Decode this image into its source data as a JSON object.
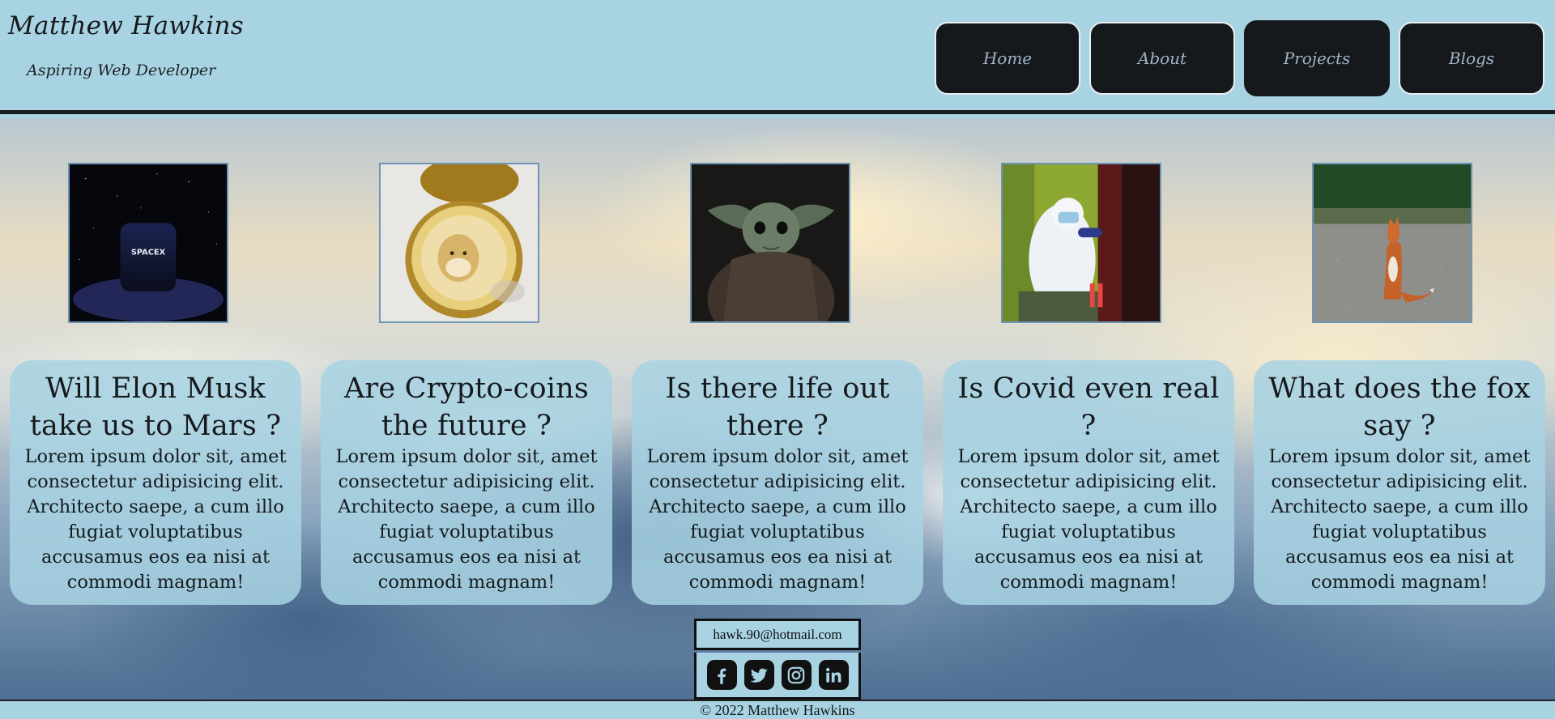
{
  "header": {
    "title": "Matthew Hawkins",
    "subtitle": "Aspiring Web Developer"
  },
  "nav": {
    "items": [
      {
        "label": "Home"
      },
      {
        "label": "About"
      },
      {
        "label": "Projects"
      },
      {
        "label": "Blogs"
      }
    ],
    "active": "Projects"
  },
  "posts": [
    {
      "image": "spacex-cube-image",
      "title": "Will Elon Musk take us to Mars ?",
      "body": "Lorem ipsum dolor sit, amet consectetur adipisicing elit. Architecto saepe, a cum illo fugiat voluptatibus accusamus eos ea nisi at commodi magnam!"
    },
    {
      "image": "dogecoin-image",
      "title": "Are Crypto-coins the future ?",
      "body": "Lorem ipsum dolor sit, amet consectetur adipisicing elit. Architecto saepe, a cum illo fugiat voluptatibus accusamus eos ea nisi at commodi magnam!"
    },
    {
      "image": "baby-yoda-image",
      "title": "Is there life out there ?",
      "body": "Lorem ipsum dolor sit, amet consectetur adipisicing elit. Architecto saepe, a cum illo fugiat voluptatibus accusamus eos ea nisi at commodi magnam!"
    },
    {
      "image": "covid-test-image",
      "title": "Is Covid even real ?",
      "body": "Lorem ipsum dolor sit, amet consectetur adipisicing elit. Architecto saepe, a cum illo fugiat voluptatibus accusamus eos ea nisi at commodi magnam!"
    },
    {
      "image": "fox-image",
      "title": "What does the fox say ?",
      "body": "Lorem ipsum dolor sit, amet consectetur adipisicing elit. Architecto saepe, a cum illo fugiat voluptatibus accusamus eos ea nisi at commodi magnam!"
    }
  ],
  "spacex_label": "SPACEX",
  "footer": {
    "email": "hawk.90@hotmail.com",
    "social": [
      "facebook-icon",
      "twitter-icon",
      "instagram-icon",
      "linkedin-icon"
    ],
    "copyright": "© 2022 Matthew Hawkins"
  },
  "colors": {
    "header_bg": "#a8d3e3",
    "nav_bg": "#16191c",
    "nav_text": "#9fb3c6",
    "card_bg": "#a8d3e3"
  }
}
